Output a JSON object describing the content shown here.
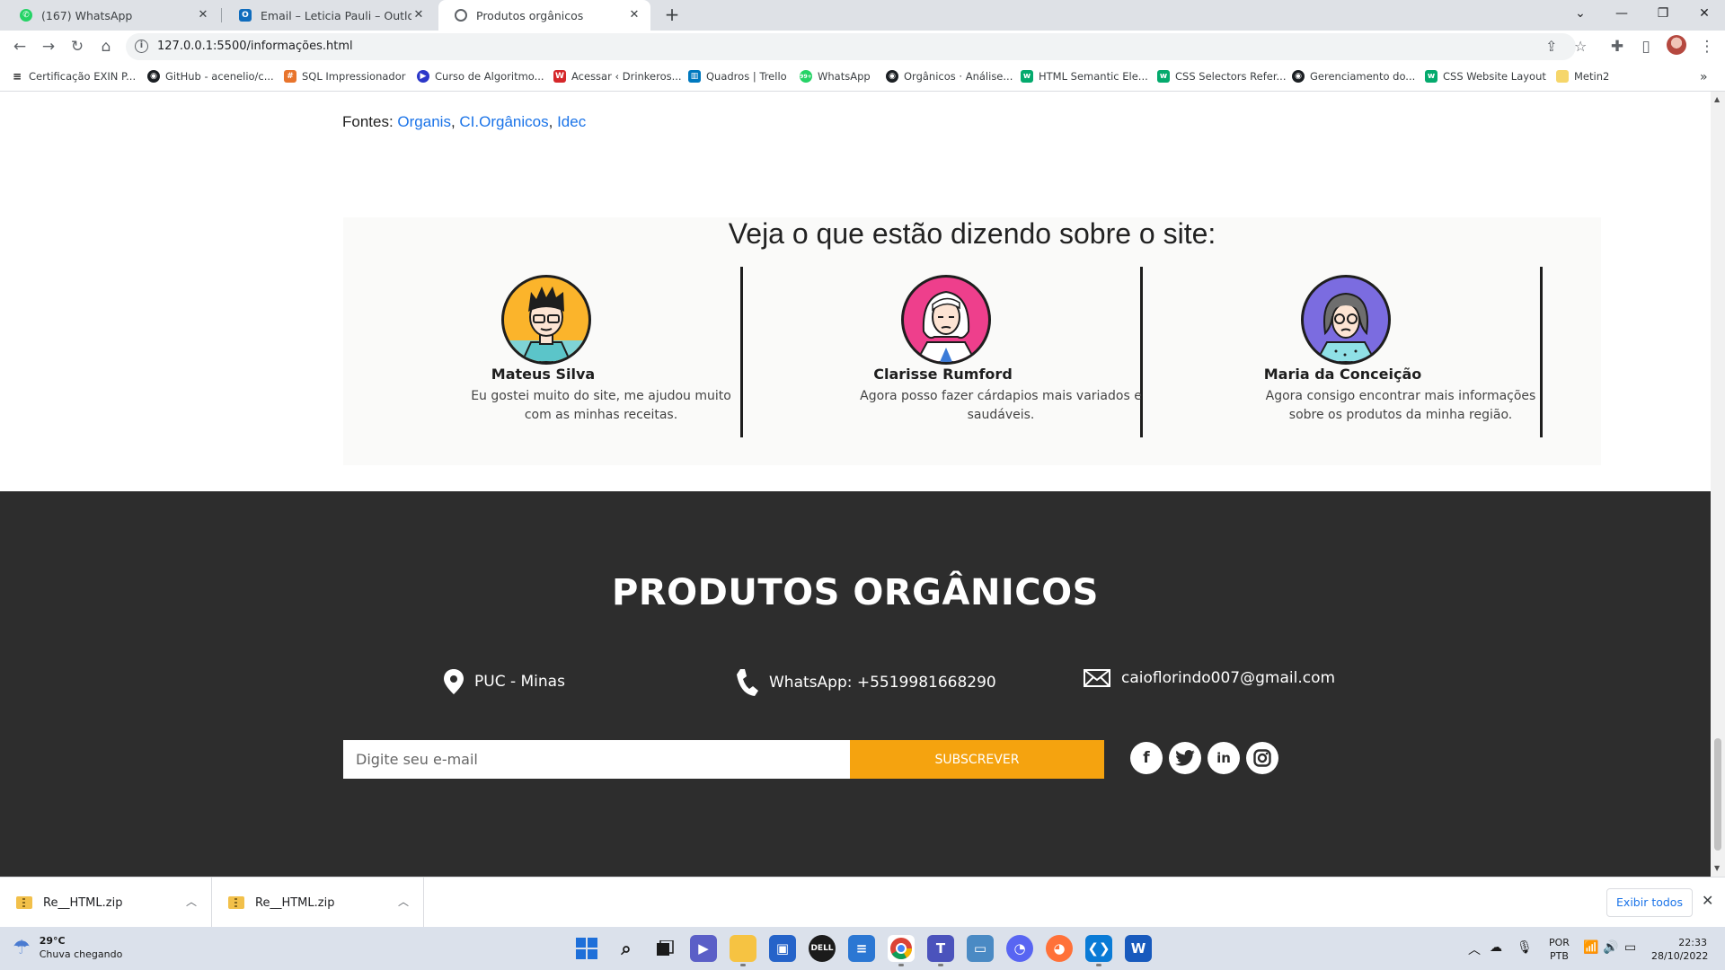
{
  "browser": {
    "tabs": [
      {
        "title": "(167) WhatsApp",
        "icon": "whatsapp-icon"
      },
      {
        "title": "Email – Leticia Pauli – Outlook",
        "icon": "outlook-icon"
      },
      {
        "title": "Produtos orgânicos",
        "icon": "globe-icon"
      }
    ],
    "url": "127.0.0.1:5500/informações.html",
    "bookmarks": [
      {
        "label": "Certificação EXIN P...",
        "icon": "exin-icon"
      },
      {
        "label": "GitHub - acenelio/c...",
        "icon": "github-icon"
      },
      {
        "label": "SQL Impressionador",
        "icon": "hashtag-icon"
      },
      {
        "label": "Curso de Algoritmo...",
        "icon": "video-icon"
      },
      {
        "label": "Acessar ‹ Drinkeros...",
        "icon": "wordpress-icon"
      },
      {
        "label": "Quadros | Trello",
        "icon": "trello-icon"
      },
      {
        "label": "WhatsApp",
        "icon": "whatsapp-icon"
      },
      {
        "label": "Orgânicos · Análise...",
        "icon": "github-icon"
      },
      {
        "label": "HTML Semantic Ele...",
        "icon": "w3schools-icon"
      },
      {
        "label": "CSS Selectors Refer...",
        "icon": "w3schools-icon"
      },
      {
        "label": "Gerenciamento do...",
        "icon": "github-icon"
      },
      {
        "label": "CSS Website Layout",
        "icon": "w3schools-icon"
      },
      {
        "label": "Metin2",
        "icon": "folder-icon"
      }
    ],
    "whatsapp_badge": "99+"
  },
  "page": {
    "sources_label": "Fontes: ",
    "sources": [
      "Organis",
      "CI.Orgânicos",
      "Idec"
    ],
    "testimonials_title": "Veja o que estão dizendo sobre o site:",
    "testimonials": [
      {
        "name": "Mateus Silva",
        "quote": "Eu gostei muito do site, me ajudou muito com as minhas receitas.",
        "avatar_color": "#fbb42b"
      },
      {
        "name": "Clarisse Rumford",
        "quote": "Agora posso fazer cárdapios mais variados e saudáveis.",
        "avatar_color": "#ee3f8c"
      },
      {
        "name": "Maria da Conceição",
        "quote": "Agora consigo encontrar mais informações sobre os produtos da minha região.",
        "avatar_color": "#7b6ce0"
      }
    ],
    "footer": {
      "brand": "PRODUTOS ORGÂNICOS",
      "location": "PUC - Minas",
      "whatsapp": "WhatsApp: +5519981668290",
      "email": "caioflorindo007@gmail.com",
      "email_placeholder": "Digite seu e-mail",
      "subscribe_label": "SUBSCREVER",
      "social": [
        "facebook-icon",
        "twitter-icon",
        "linkedin-icon",
        "instagram-icon"
      ]
    },
    "colors": {
      "footer_bg": "#2d2d2d",
      "accent": "#f5a30f",
      "link": "#1a73e8"
    }
  },
  "downloads": {
    "items": [
      "Re__HTML.zip",
      "Re__HTML.zip"
    ],
    "show_all": "Exibir todos"
  },
  "taskbar": {
    "temperature": "29°C",
    "weather": "Chuva chegando",
    "language": "POR",
    "layout": "PTB",
    "time": "22:33",
    "date": "28/10/2022"
  }
}
